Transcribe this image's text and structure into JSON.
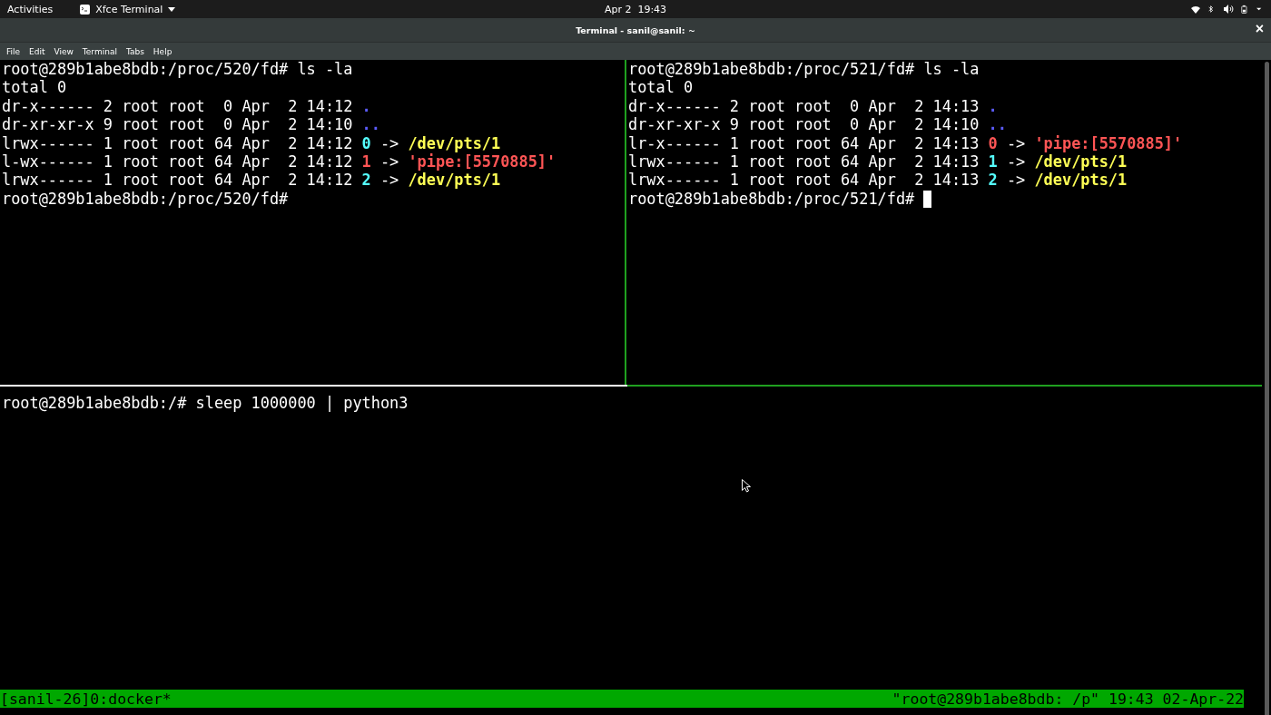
{
  "top_bar": {
    "activities": "Activities",
    "app": "Xfce Terminal",
    "clock": "Apr 2  19:43"
  },
  "window": {
    "title": "Terminal - sanil@sanil: ~",
    "close": "×"
  },
  "menu": [
    "File",
    "Edit",
    "View",
    "Terminal",
    "Tabs",
    "Help"
  ],
  "panes": [
    {
      "cursor": false,
      "lines": [
        [
          {
            "kind": "plain",
            "text": "root@289b1abe8bdb:/proc/520/fd# ls -la"
          }
        ],
        [
          {
            "kind": "plain",
            "text": "total 0"
          }
        ],
        [
          {
            "kind": "plain",
            "text": "dr-x------ 2 root root  0 Apr  2 14:12 "
          },
          {
            "kind": "dir",
            "text": "."
          }
        ],
        [
          {
            "kind": "plain",
            "text": "dr-xr-xr-x 9 root root  0 Apr  2 14:10 "
          },
          {
            "kind": "dir",
            "text": ".."
          }
        ],
        [
          {
            "kind": "plain",
            "text": "lrwx------ 1 root root 64 Apr  2 14:12 "
          },
          {
            "kind": "fd",
            "text": "0"
          },
          {
            "kind": "plain",
            "text": " -> "
          },
          {
            "kind": "link",
            "text": "/dev/pts/1"
          }
        ],
        [
          {
            "kind": "plain",
            "text": "l-wx------ 1 root root 64 Apr  2 14:12 "
          },
          {
            "kind": "pipe",
            "text": "1"
          },
          {
            "kind": "plain",
            "text": " -> "
          },
          {
            "kind": "pipe",
            "text": "'pipe:[5570885]'"
          }
        ],
        [
          {
            "kind": "plain",
            "text": "lrwx------ 1 root root 64 Apr  2 14:12 "
          },
          {
            "kind": "fd",
            "text": "2"
          },
          {
            "kind": "plain",
            "text": " -> "
          },
          {
            "kind": "link",
            "text": "/dev/pts/1"
          }
        ],
        [
          {
            "kind": "plain",
            "text": "root@289b1abe8bdb:/proc/520/fd#"
          }
        ]
      ]
    },
    {
      "cursor": true,
      "lines": [
        [
          {
            "kind": "plain",
            "text": "root@289b1abe8bdb:/proc/521/fd# ls -la"
          }
        ],
        [
          {
            "kind": "plain",
            "text": "total 0"
          }
        ],
        [
          {
            "kind": "plain",
            "text": "dr-x------ 2 root root  0 Apr  2 14:13 "
          },
          {
            "kind": "dir",
            "text": "."
          }
        ],
        [
          {
            "kind": "plain",
            "text": "dr-xr-xr-x 9 root root  0 Apr  2 14:10 "
          },
          {
            "kind": "dir",
            "text": ".."
          }
        ],
        [
          {
            "kind": "plain",
            "text": "lr-x------ 1 root root 64 Apr  2 14:13 "
          },
          {
            "kind": "pipe",
            "text": "0"
          },
          {
            "kind": "plain",
            "text": " -> "
          },
          {
            "kind": "pipe",
            "text": "'pipe:[5570885]'"
          }
        ],
        [
          {
            "kind": "plain",
            "text": "lrwx------ 1 root root 64 Apr  2 14:13 "
          },
          {
            "kind": "fd",
            "text": "1"
          },
          {
            "kind": "plain",
            "text": " -> "
          },
          {
            "kind": "link",
            "text": "/dev/pts/1"
          }
        ],
        [
          {
            "kind": "plain",
            "text": "lrwx------ 1 root root 64 Apr  2 14:13 "
          },
          {
            "kind": "fd",
            "text": "2"
          },
          {
            "kind": "plain",
            "text": " -> "
          },
          {
            "kind": "link",
            "text": "/dev/pts/1"
          }
        ],
        [
          {
            "kind": "plain",
            "text": "root@289b1abe8bdb:/proc/521/fd# "
          }
        ]
      ]
    },
    {
      "cursor": false,
      "lines": [
        [
          {
            "kind": "plain",
            "text": "root@289b1abe8bdb:/# sleep 1000000 | python3"
          }
        ]
      ]
    }
  ],
  "status_bar": {
    "left": "[sanil-26]0:docker*",
    "right": "\"root@289b1abe8bdb: /p\" 19:43 02-Apr-22"
  }
}
